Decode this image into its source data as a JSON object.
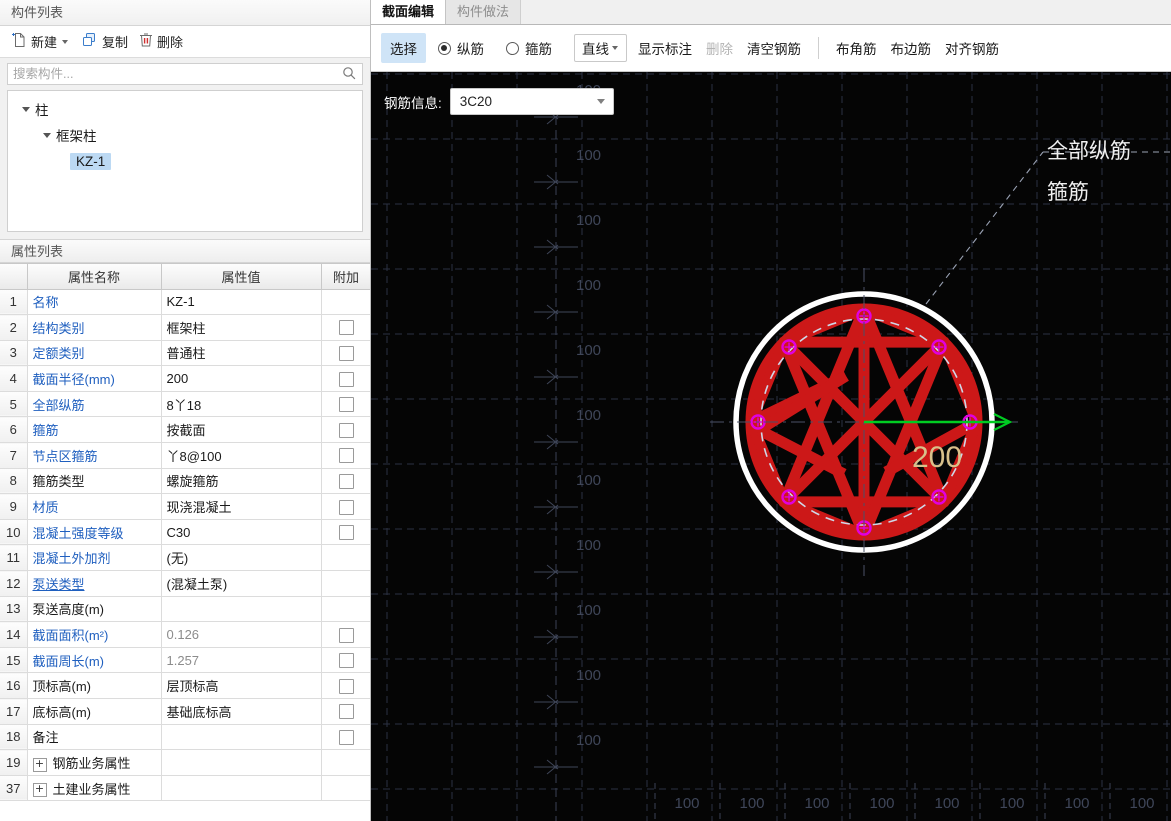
{
  "component_panel": {
    "title": "构件列表",
    "toolbar": [
      {
        "label": "新建",
        "icon": "new-file-icon",
        "has_caret": true
      },
      {
        "label": "复制",
        "icon": "copy-icon",
        "has_caret": false
      },
      {
        "label": "删除",
        "icon": "trash-icon",
        "has_caret": false
      }
    ],
    "search": {
      "placeholder": "搜索构件...",
      "value": "",
      "icon": "search-icon"
    },
    "tree": [
      {
        "label": "柱",
        "level": 1,
        "expanded": true,
        "selected": false
      },
      {
        "label": "框架柱",
        "level": 2,
        "expanded": true,
        "selected": false
      },
      {
        "label": "KZ-1",
        "level": 3,
        "expanded": false,
        "selected": true
      }
    ]
  },
  "property_panel": {
    "title": "属性列表",
    "headers": {
      "index": "",
      "name": "属性名称",
      "value": "属性值",
      "addition": "附加"
    },
    "rows": [
      {
        "idx": "1",
        "name": "名称",
        "value": "KZ-1",
        "name_style": "link",
        "value_style": "normal",
        "checkbox": false,
        "expander": false
      },
      {
        "idx": "2",
        "name": "结构类别",
        "value": "框架柱",
        "name_style": "link",
        "value_style": "normal",
        "checkbox": true,
        "expander": false
      },
      {
        "idx": "3",
        "name": "定额类别",
        "value": "普通柱",
        "name_style": "link",
        "value_style": "normal",
        "checkbox": true,
        "expander": false
      },
      {
        "idx": "4",
        "name": "截面半径(mm)",
        "value": "200",
        "name_style": "link",
        "value_style": "normal",
        "checkbox": true,
        "expander": false
      },
      {
        "idx": "5",
        "name": "全部纵筋",
        "value": "8丫18",
        "name_style": "link",
        "value_style": "normal",
        "checkbox": true,
        "expander": false
      },
      {
        "idx": "6",
        "name": "箍筋",
        "value": "按截面",
        "name_style": "link",
        "value_style": "normal",
        "checkbox": true,
        "expander": false
      },
      {
        "idx": "7",
        "name": "节点区箍筋",
        "value": "丫8@100",
        "name_style": "link",
        "value_style": "normal",
        "checkbox": true,
        "expander": false
      },
      {
        "idx": "8",
        "name": "箍筋类型",
        "value": "螺旋箍筋",
        "name_style": "plain",
        "value_style": "normal",
        "checkbox": true,
        "expander": false
      },
      {
        "idx": "9",
        "name": "材质",
        "value": "现浇混凝土",
        "name_style": "link",
        "value_style": "normal",
        "checkbox": true,
        "expander": false
      },
      {
        "idx": "10",
        "name": "混凝土强度等级",
        "value": "C30",
        "name_style": "link",
        "value_style": "normal",
        "checkbox": true,
        "expander": false
      },
      {
        "idx": "11",
        "name": "混凝土外加剂",
        "value": "(无)",
        "name_style": "link",
        "value_style": "normal",
        "checkbox": false,
        "expander": false
      },
      {
        "idx": "12",
        "name": "泵送类型",
        "value": "(混凝土泵)",
        "name_style": "link-underline",
        "value_style": "normal",
        "checkbox": false,
        "expander": false
      },
      {
        "idx": "13",
        "name": "泵送高度(m)",
        "value": "",
        "name_style": "plain",
        "value_style": "normal",
        "checkbox": false,
        "expander": false
      },
      {
        "idx": "14",
        "name": "截面面积(m²)",
        "value": "0.126",
        "name_style": "link",
        "value_style": "muted",
        "checkbox": true,
        "expander": false
      },
      {
        "idx": "15",
        "name": "截面周长(m)",
        "value": "1.257",
        "name_style": "link",
        "value_style": "muted",
        "checkbox": true,
        "expander": false
      },
      {
        "idx": "16",
        "name": "顶标高(m)",
        "value": "层顶标高",
        "name_style": "plain",
        "value_style": "normal",
        "checkbox": true,
        "expander": false
      },
      {
        "idx": "17",
        "name": "底标高(m)",
        "value": "基础底标高",
        "name_style": "plain",
        "value_style": "normal",
        "checkbox": true,
        "expander": false
      },
      {
        "idx": "18",
        "name": "备注",
        "value": "",
        "name_style": "plain",
        "value_style": "normal",
        "checkbox": true,
        "expander": false
      },
      {
        "idx": "19",
        "name": "钢筋业务属性",
        "value": "",
        "name_style": "plain",
        "value_style": "normal",
        "checkbox": false,
        "expander": true
      },
      {
        "idx": "37",
        "name": "土建业务属性",
        "value": "",
        "name_style": "plain",
        "value_style": "normal",
        "checkbox": false,
        "expander": true
      }
    ],
    "expander_glyph": "+"
  },
  "tabs": [
    {
      "label": "截面编辑",
      "active": true
    },
    {
      "label": "构件做法",
      "active": false
    }
  ],
  "section_toolbar": {
    "select_label": "选择",
    "radios": [
      {
        "label": "纵筋",
        "checked": true
      },
      {
        "label": "箍筋",
        "checked": false
      }
    ],
    "line_tool": {
      "label": "直线",
      "has_caret": true
    },
    "items": [
      {
        "label": "显示标注",
        "disabled": false
      },
      {
        "label": "删除",
        "disabled": true
      },
      {
        "label": "清空钢筋",
        "disabled": false
      }
    ],
    "items2": [
      {
        "label": "布角筋",
        "disabled": false
      },
      {
        "label": "布边筋",
        "disabled": false
      },
      {
        "label": "对齐钢筋",
        "disabled": false
      }
    ]
  },
  "canvas": {
    "rebar_info": {
      "label": "钢筋信息:",
      "value": "3C20"
    },
    "annotations": [
      {
        "text": "全部纵筋"
      },
      {
        "text": "箍筋"
      }
    ],
    "radius_label": "200",
    "ruler_vertical": [
      "100",
      "100",
      "100",
      "100",
      "100",
      "100",
      "100",
      "100",
      "100",
      "100",
      "100"
    ],
    "ruler_horizontal": [
      "100",
      "100",
      "100",
      "100",
      "100",
      "100",
      "100",
      "100"
    ],
    "colors": {
      "background": "#050505",
      "grid": "#2b3142",
      "concrete_outline": "#ffffff",
      "rebar": "#cc1818",
      "marker": "#e000e0",
      "radius_arrow": "#00cc22",
      "dimension_text": "#d8c08a",
      "annotation_text": "#f0f0f0"
    }
  }
}
